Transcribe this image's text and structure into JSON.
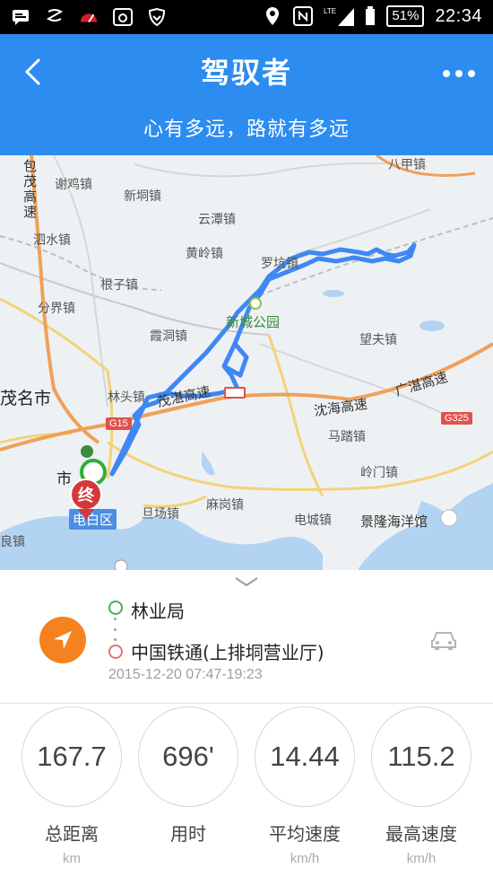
{
  "status_bar": {
    "battery": "51%",
    "network": "LTE",
    "time": "22:34"
  },
  "header": {
    "title": "驾驭者",
    "subtitle": "心有多远，路就有多远",
    "accent": "#2d8cf0"
  },
  "map": {
    "labels": {
      "baomao": "包茂高速",
      "xieji": "谢鸡镇",
      "xindong": "新垌镇",
      "yuntan": "云潭镇",
      "sishui": "泗水镇",
      "huangling": "黄岭镇",
      "luokeng": "罗坑镇",
      "genzi": "根子镇",
      "fenjie": "分界镇",
      "lutong": "霞洞镇",
      "xincheng_park": "新城公园",
      "wangfu": "望夫镇",
      "maoming": "茂名市",
      "lintou": "林头镇",
      "maozhan_hwy": "茂湛高速",
      "shenhai_hwy": "沈海高速",
      "guangzhan_hwy": "广湛高速",
      "malu": "马踏镇",
      "lingmen": "岭门镇",
      "danchang": "旦场镇",
      "magang": "麻岗镇",
      "diancheng": "电城镇",
      "jinglong": "景隆海洋馆",
      "shi": "市",
      "liang": "良镇",
      "bashen": "八甲镇",
      "district": "电白区",
      "g15": "G15",
      "g325": "G325",
      "end_marker": "终"
    }
  },
  "trip": {
    "start": "林业局",
    "end": "中国铁通(上排垌营业厅)",
    "time_range": "2015-12-20 07:47-19:23",
    "stats": [
      {
        "value": "167.7",
        "name": "总距离",
        "unit": "km"
      },
      {
        "value": "696'",
        "name": "用时",
        "unit": ""
      },
      {
        "value": "14.44",
        "name": "平均速度",
        "unit": "km/h"
      },
      {
        "value": "115.2",
        "name": "最高速度",
        "unit": "km/h"
      }
    ]
  }
}
